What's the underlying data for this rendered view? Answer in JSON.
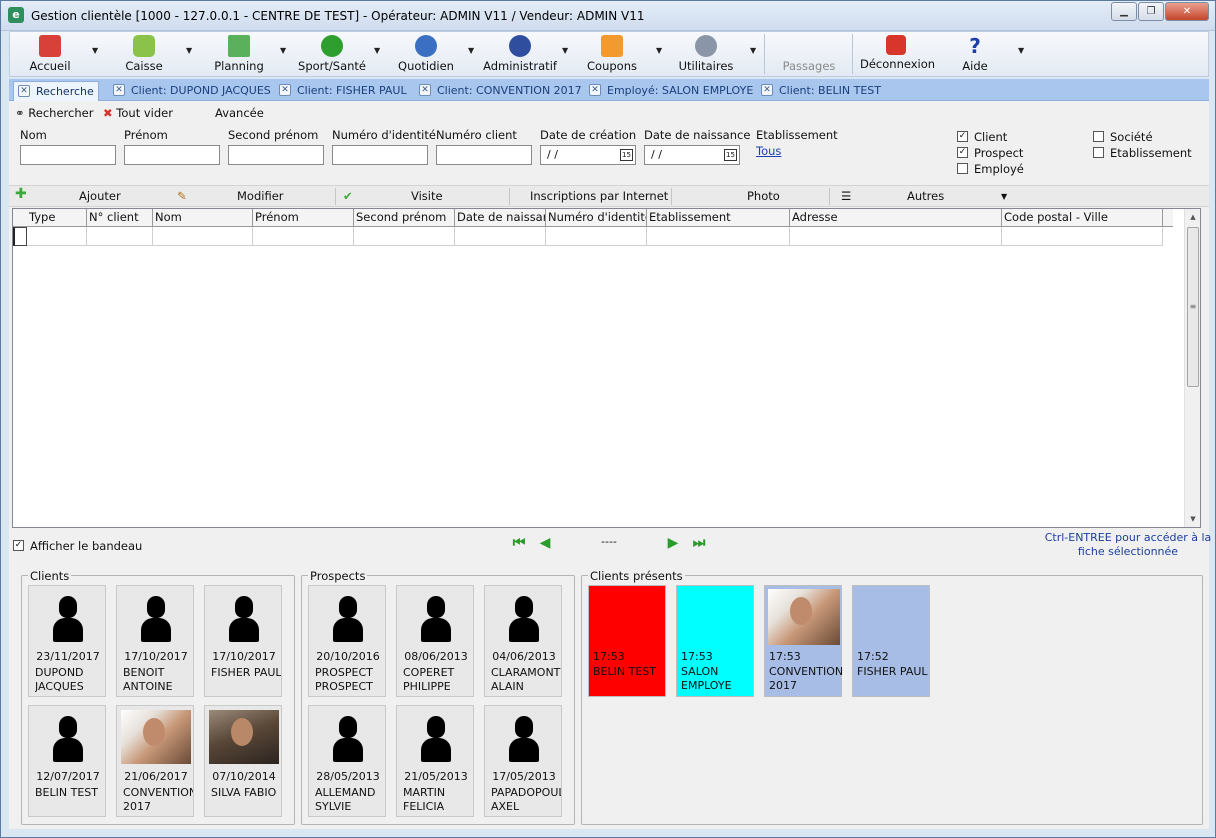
{
  "window": {
    "title": "Gestion clientèle [1000 - 127.0.0.1 - CENTRE DE TEST] - Opérateur: ADMIN V11 / Vendeur: ADMIN V11"
  },
  "toolbar": {
    "items": [
      {
        "label": "Accueil",
        "icon": "house-icon",
        "color": "#d8403a"
      },
      {
        "label": "Caisse",
        "icon": "cart-icon",
        "color": "#8bc34a"
      },
      {
        "label": "Planning",
        "icon": "calendar-icon",
        "color": "#5bb05b"
      },
      {
        "label": "Sport/Santé",
        "icon": "runner-icon",
        "color": "#2e9e2e"
      },
      {
        "label": "Quotidien",
        "icon": "clock-icon",
        "color": "#3a6fc2"
      },
      {
        "label": "Administratif",
        "icon": "euro-icon",
        "color": "#2f4f9e"
      },
      {
        "label": "Coupons",
        "icon": "coupon-icon",
        "color": "#f29a2e"
      },
      {
        "label": "Utilitaires",
        "icon": "gear-icon",
        "color": "#8a96a8"
      },
      {
        "label": "Passages"
      },
      {
        "label": "Déconnexion",
        "icon": "power-icon",
        "color": "#d9362b"
      },
      {
        "label": "Aide",
        "icon": "question-icon",
        "color": "#1e3ea8"
      }
    ]
  },
  "tabs": [
    {
      "label": "Recherche"
    },
    {
      "label": "Client: DUPOND JACQUES"
    },
    {
      "label": "Client: FISHER PAUL"
    },
    {
      "label": "Client: CONVENTION 2017"
    },
    {
      "label": "Employé: SALON EMPLOYE"
    },
    {
      "label": "Client: BELIN TEST"
    }
  ],
  "search_bar": {
    "search": "Rechercher",
    "clear": "Tout vider",
    "advanced": "Avancée"
  },
  "fields": {
    "nom": "Nom",
    "prenom": "Prénom",
    "second_prenom": "Second prénom",
    "numero_identite": "Numéro d'identité",
    "numero_client": "Numéro client",
    "date_creation": "Date de création",
    "date_naissance": "Date de naissance",
    "date_placeholder": "/ /",
    "etablissement": "Etablissement",
    "etablissement_link": "Tous"
  },
  "filters": {
    "client": {
      "label": "Client",
      "checked": "✓"
    },
    "prospect": {
      "label": "Prospect",
      "checked": "✓"
    },
    "employe": {
      "label": "Employé"
    },
    "societe": {
      "label": "Société"
    },
    "etablissement": {
      "label": "Etablissement"
    }
  },
  "actions": {
    "ajouter": "Ajouter",
    "modifier": "Modifier",
    "visite": "Visite",
    "inscriptions": "Inscriptions par Internet",
    "photo": "Photo",
    "autres": "Autres"
  },
  "grid": {
    "columns": [
      "Type",
      "N° client",
      "Nom",
      "Prénom",
      "Second prénom",
      "Date de naissan",
      "Numéro d'identité",
      "Etablissement",
      "Adresse",
      "Code postal - Ville"
    ]
  },
  "nav": {
    "afficher_bandeau": "Afficher le bandeau",
    "afficher_bandeau_checked": "✓",
    "position": "----",
    "hint_line1": "Ctrl-ENTREE pour accéder à la",
    "hint_line2": "fiche sélectionnée"
  },
  "clients": {
    "title": "Clients",
    "cards": [
      {
        "date": "23/11/2017",
        "name": "DUPOND\nJACQUES"
      },
      {
        "date": "17/10/2017",
        "name": "BENOIT\nANTOINE"
      },
      {
        "date": "17/10/2017",
        "name": "FISHER PAUL"
      },
      {
        "date": "12/07/2017",
        "name": "BELIN TEST"
      },
      {
        "date": "21/06/2017",
        "name": "CONVENTION\n2017"
      },
      {
        "date": "07/10/2014",
        "name": "SILVA FABIO"
      }
    ]
  },
  "prospects": {
    "title": "Prospects",
    "cards": [
      {
        "date": "20/10/2016",
        "name": "PROSPECT\nPROSPECT"
      },
      {
        "date": "08/06/2013",
        "name": "COPERET\nPHILIPPE"
      },
      {
        "date": "04/06/2013",
        "name": "CLARAMONT\nALAIN"
      },
      {
        "date": "28/05/2013",
        "name": "ALLEMAND\nSYLVIE"
      },
      {
        "date": "21/05/2013",
        "name": "MARTIN\nFELICIA"
      },
      {
        "date": "17/05/2013",
        "name": "PAPADOPOUL\nAXEL"
      }
    ]
  },
  "presents": {
    "title": "Clients présents",
    "cards": [
      {
        "time": "17:53",
        "name": "BELIN TEST",
        "color": "#ff0000"
      },
      {
        "time": "17:53",
        "name": "SALON\nEMPLOYE",
        "color": "#00ffff"
      },
      {
        "time": "17:53",
        "name": "CONVENTION\n2017",
        "color": "#a7bde6"
      },
      {
        "time": "17:52",
        "name": "FISHER PAUL",
        "color": "#a7bde6"
      }
    ]
  }
}
